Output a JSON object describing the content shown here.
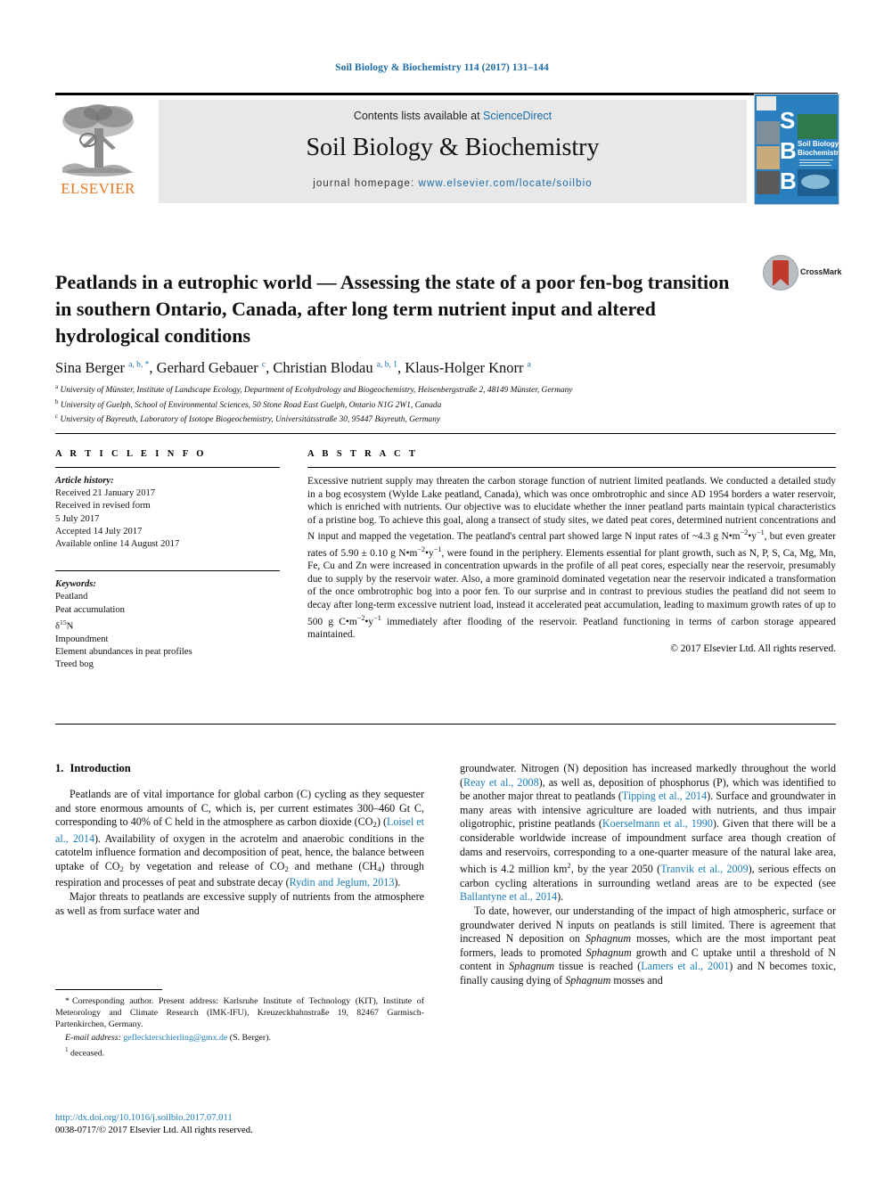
{
  "running_head": "Soil Biology & Biochemistry 114 (2017) 131–144",
  "masthead": {
    "publisher_name": "ELSEVIER",
    "contents_prefix": "Contents lists available at ",
    "contents_link": "ScienceDirect",
    "journal_name": "Soil Biology & Biochemistry",
    "homepage_prefix": "journal homepage: ",
    "homepage_url": "www.elsevier.com/locate/soilbio",
    "cover_letters": [
      "S",
      "B",
      "B"
    ],
    "cover_title": "Soil Biology & Biochemistry"
  },
  "article": {
    "title": "Peatlands in a eutrophic world — Assessing the state of a poor fen-bog transition in southern Ontario, Canada, after long term nutrient input and altered hydrological conditions",
    "crossmark_label": "CrossMark",
    "authors_html": "Sina Berger <sup>a, b, *</sup>, Gerhard Gebauer <sup>c</sup>, Christian Blodau <sup>a, b, 1</sup>, Klaus-Holger Knorr <sup>a</sup>",
    "affiliations": [
      "University of Münster, Institute of Landscape Ecology, Department of Ecohydrology and Biogeochemistry, Heisenbergstraße 2, 48149 Münster, Germany",
      "University of Guelph, School of Environmental Sciences, 50 Stone Road East Guelph, Ontario N1G 2W1, Canada",
      "University of Bayreuth, Laboratory of Isotope Biogeochemistry, Universitätsstraße 30, 95447 Bayreuth, Germany"
    ],
    "affiliation_marks": [
      "a",
      "b",
      "c"
    ]
  },
  "article_info": {
    "heading": "A R T I C L E  I N F O",
    "history_label": "Article history:",
    "history": [
      "Received 21 January 2017",
      "Received in revised form",
      "5 July 2017",
      "Accepted 14 July 2017",
      "Available online 14 August 2017"
    ],
    "keywords_label": "Keywords:",
    "keywords": [
      "Peatland",
      "Peat accumulation",
      "δ15N",
      "Impoundment",
      "Element abundances in peat profiles",
      "Treed bog"
    ]
  },
  "abstract": {
    "heading": "A B S T R A C T",
    "text_html": "Excessive nutrient supply may threaten the carbon storage function of nutrient limited peatlands. We conducted a detailed study in a bog ecosystem (Wylde Lake peatland, Canada), which was once ombrotrophic and since AD 1954 borders a water reservoir, which is enriched with nutrients. Our objective was to elucidate whether the inner peatland parts maintain typical characteristics of a pristine bog. To achieve this goal, along a transect of study sites, we dated peat cores, determined nutrient concentrations and N input and mapped the vegetation. The peatland's central part showed large N input rates of ~4.3 g N&bull;m<sup class=\"num\">&minus;2</sup>&bull;y<sup class=\"num\">&minus;1</sup>, but even greater rates of 5.90 &plusmn; 0.10 g N&bull;m<sup class=\"num\">&minus;2</sup>&bull;y<sup class=\"num\">&minus;1</sup>, were found in the periphery. Elements essential for plant growth, such as N, P, S, Ca, Mg, Mn, Fe, Cu and Zn were increased in concentration upwards in the profile of all peat cores, especially near the reservoir, presumably due to supply by the reservoir water. Also, a more graminoid dominated vegetation near the reservoir indicated a transformation of the once ombrotrophic bog into a poor fen. To our surprise and in contrast to previous studies the peatland did not seem to decay after long-term excessive nutrient load, instead it accelerated peat accumulation, leading to maximum growth rates of up to 500 g C&bull;m<sup class=\"num\">&minus;2</sup>&bull;y<sup class=\"num\">&minus;1</sup> immediately after flooding of the reservoir. Peatland functioning in terms of carbon storage appeared maintained.",
    "copyright": "© 2017 Elsevier Ltd. All rights reserved."
  },
  "introduction": {
    "number": "1.",
    "heading": "Introduction",
    "left_paragraphs_html": [
      "Peatlands are of vital importance for global carbon (C) cycling as they sequester and store enormous amounts of C, which is, per current estimates 300–460 Gt C, corresponding to 40% of C held in the atmosphere as carbon dioxide (CO<sub>2</sub>) (<span class=\"ref\">Loisel et al., 2014</span>). Availability of oxygen in the acrotelm and anaerobic conditions in the catotelm influence formation and decomposition of peat, hence, the balance between uptake of CO<sub>2</sub> by vegetation and release of CO<sub>2</sub> and methane (CH<sub>4</sub>) through respiration and processes of peat and substrate decay (<span class=\"ref\">Rydin and Jeglum, 2013</span>).",
      "Major threats to peatlands are excessive supply of nutrients from the atmosphere as well as from surface water and"
    ],
    "right_paragraphs_html": [
      "groundwater. Nitrogen (N) deposition has increased markedly throughout the world (<span class=\"ref\">Reay et al., 2008</span>), as well as, deposition of phosphorus (P), which was identified to be another major threat to peatlands (<span class=\"ref\">Tipping et al., 2014</span>). Surface and groundwater in many areas with intensive agriculture are loaded with nutrients, and thus impair oligotrophic, pristine peatlands (<span class=\"ref\">Koerselmann et al., 1990</span>). Given that there will be a considerable worldwide increase of impoundment surface area though creation of dams and reservoirs, corresponding to a one-quarter measure of the natural lake area, which is 4.2 million km<sup class=\"num\">2</sup>, by the year 2050 (<span class=\"ref\">Tranvik et al., 2009</span>), serious effects on carbon cycling alterations in surrounding wetland areas are to be expected (see <span class=\"ref\">Ballantyne et al., 2014</span>).",
      "To date, however, our understanding of the impact of high atmospheric, surface or groundwater derived N inputs on peatlands is still limited. There is agreement that increased N deposition on <span class=\"it\">Sphagnum</span> mosses, which are the most important peat formers, leads to promoted <span class=\"it\">Sphagnum</span> growth and C uptake until a threshold of N content in <span class=\"it\">Sphagnum</span> tissue is reached (<span class=\"ref\">Lamers et al., 2001</span>) and N becomes toxic, finally causing dying of <span class=\"it\">Sphagnum</span> mosses and"
    ]
  },
  "footnotes": {
    "corresponding_mark": "*",
    "corresponding_html": "Corresponding author. Present address: Karlsruhe Institute of Technology (KIT), Institute of Meteorology and Climate Research (IMK-IFU), Kreuzeckbahnstraße 19, 82467 Garmisch-Partenkirchen, Germany.",
    "email_label": "E-mail address:",
    "email": "gefleckterschierling@gmx.de",
    "email_owner": "(S. Berger).",
    "note_mark": "1",
    "note_text": "deceased."
  },
  "footer": {
    "doi": "http://dx.doi.org/10.1016/j.soilbio.2017.07.011",
    "issn_copyright": "0038-0717/© 2017 Elsevier Ltd. All rights reserved."
  },
  "colors": {
    "link": "#1a7cb8",
    "elsevier_orange": "#e87722",
    "cover_blue": "#2a7fbf",
    "masthead_gray": "#e8e8e8"
  }
}
